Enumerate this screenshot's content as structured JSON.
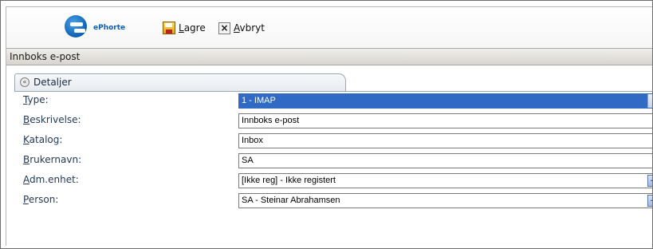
{
  "toolbar": {
    "logo_text": "ePhorte",
    "save_accel": "L",
    "save_rest": "agre",
    "cancel_accel": "A",
    "cancel_rest": "vbryt",
    "cancel_glyph": "×"
  },
  "header": {
    "title": "Innboks e-post"
  },
  "tab": {
    "label": "Detaljer",
    "collapse_glyph": "«"
  },
  "form": {
    "rows": [
      {
        "accel": "T",
        "rest": "ype:",
        "value": "1 - IMAP",
        "control": "dropdown"
      },
      {
        "accel": "B",
        "rest": "eskrivelse:",
        "value": "Innboks e-post",
        "control": "text"
      },
      {
        "accel": "K",
        "rest": "atalog:",
        "value": "Inbox",
        "control": "text"
      },
      {
        "accel": "B",
        "rest": "rukernavn:",
        "value": "SA",
        "control": "text"
      },
      {
        "accel": "A",
        "rest": "dm.enhet:",
        "value": "[Ikke reg] - Ikke registert",
        "control": "lookup"
      },
      {
        "accel": "P",
        "rest": "erson:",
        "value": "SA - Steinar Abrahamsen",
        "control": "lookup"
      }
    ],
    "dropdown_glyph": "▼",
    "lookup_glyph": "..."
  },
  "colors": {
    "selection": "#316ac5",
    "label_text": "#243a5a",
    "logo_blue": "#0d5fb4"
  }
}
